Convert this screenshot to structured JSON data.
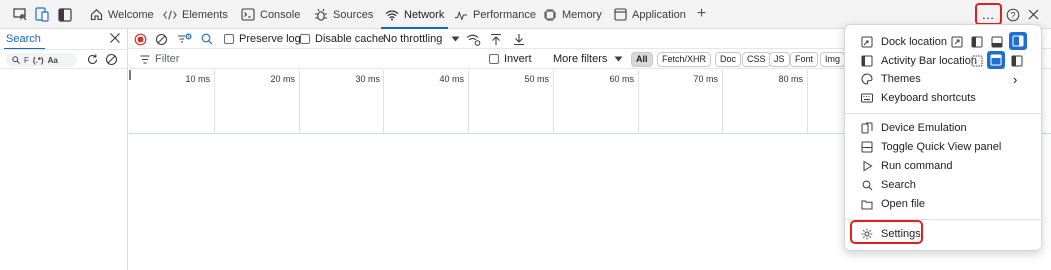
{
  "tabs": [
    {
      "id": "welcome",
      "label": "Welcome",
      "icon": "home-icon",
      "active": false
    },
    {
      "id": "elements",
      "label": "Elements",
      "icon": "code-brackets-icon",
      "active": false
    },
    {
      "id": "console",
      "label": "Console",
      "icon": "console-icon",
      "active": false
    },
    {
      "id": "sources",
      "label": "Sources",
      "icon": "bug-icon",
      "active": false
    },
    {
      "id": "network",
      "label": "Network",
      "icon": "wifi-icon",
      "active": true
    },
    {
      "id": "performance",
      "label": "Performance",
      "icon": "performance-icon",
      "active": false
    },
    {
      "id": "memory",
      "label": "Memory",
      "icon": "memory-chip-icon",
      "active": false
    },
    {
      "id": "application",
      "label": "Application",
      "icon": "app-window-icon",
      "active": false
    }
  ],
  "topbar": {
    "add_tab": "+",
    "more": "…",
    "help": "?",
    "close": "✕"
  },
  "search_panel": {
    "tab_label": "Search",
    "search_prefix": "F",
    "regex_label": "(.*)",
    "case_label": "Aa"
  },
  "network_toolbar": {
    "preserve_log": "Preserve log",
    "disable_cache": "Disable cache",
    "throttling": "No throttling"
  },
  "filter_bar": {
    "placeholder": "Filter",
    "invert": "Invert",
    "more_filters": "More filters",
    "chips": [
      "All",
      "Fetch/XHR",
      "Doc",
      "CSS",
      "JS",
      "Font",
      "Img"
    ],
    "selected_chip": "All"
  },
  "timeline": {
    "ticks": [
      "10 ms",
      "20 ms",
      "30 ms",
      "40 ms",
      "50 ms",
      "60 ms",
      "70 ms",
      "80 ms"
    ]
  },
  "menu": {
    "dock_location": "Dock location",
    "activity_bar_location": "Activity Bar location",
    "themes": "Themes",
    "keyboard_shortcuts": "Keyboard shortcuts",
    "device_emulation": "Device Emulation",
    "toggle_quick_view": "Toggle Quick View panel",
    "run_command": "Run command",
    "search": "Search",
    "open_file": "Open file",
    "settings": "Settings",
    "themes_arrow": "›"
  },
  "colors": {
    "accent": "#0f6cbd",
    "highlight": "#e02020",
    "record": "#d93025"
  }
}
